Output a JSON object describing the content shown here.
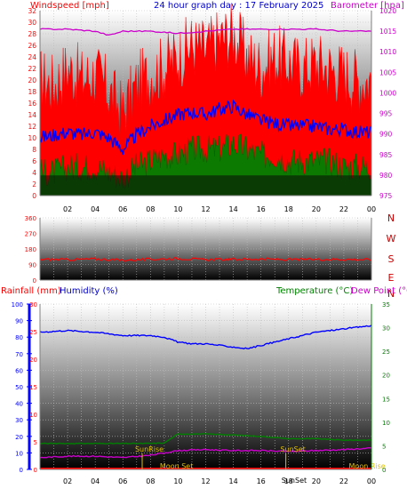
{
  "titles": {
    "main": "24 hour graph day : 17 February 2025",
    "windspeed": "Windspeed [mph]",
    "barometer": "Barometer [hpa]",
    "rainfall": "Rainfall (mm)",
    "humidity": "Humidity (%)",
    "temperature": "Temperature (°C)",
    "dewpoint": "Dew Point (°C)"
  },
  "colors": {
    "wind": "#ff0000",
    "gust_area": "#ff0000",
    "wind_avg": "#0000ff",
    "wind_low": "#008000",
    "barometer": "#cc00cc",
    "direction": "#ff0000",
    "humidity": "#0000ff",
    "temperature": "#008000",
    "dewpoint": "#cc00cc",
    "rain": "#ff0000",
    "sun": "#e0c000",
    "axis_left": "#ff0000",
    "axis_left2": "#0000ff",
    "axis_right_green": "#008000"
  },
  "chart_data": [
    {
      "type": "line",
      "title": "24 hour graph day : 17 February 2025",
      "x_ticks": [
        "02",
        "04",
        "06",
        "08",
        "10",
        "12",
        "14",
        "16",
        "18",
        "20",
        "22",
        "00"
      ],
      "ylabel": "Windspeed [mph]",
      "ylim": [
        0,
        32
      ],
      "y_ticks": [
        0,
        2,
        4,
        6,
        8,
        10,
        12,
        14,
        16,
        18,
        20,
        22,
        24,
        26,
        28,
        30,
        32
      ],
      "y2label": "Barometer [hpa]",
      "y2lim": [
        975,
        1020
      ],
      "y2_ticks": [
        975,
        980,
        985,
        990,
        995,
        1000,
        1005,
        1010,
        1015,
        1020
      ],
      "series": [
        {
          "key": "gust",
          "x": [
            0,
            1,
            2,
            3,
            4,
            5,
            6,
            7,
            8,
            9,
            10,
            11,
            12,
            13,
            14,
            15,
            16,
            17,
            18,
            19,
            20,
            21,
            22,
            23,
            24
          ],
          "values": [
            20,
            19,
            22,
            20,
            21,
            18,
            14,
            19,
            21,
            22,
            24,
            26,
            25,
            27,
            28,
            24,
            22,
            24,
            23,
            22,
            23,
            22,
            21,
            20,
            20
          ]
        },
        {
          "key": "avg",
          "x": [
            0,
            1,
            2,
            3,
            4,
            5,
            6,
            7,
            8,
            9,
            10,
            11,
            12,
            13,
            14,
            15,
            16,
            17,
            18,
            19,
            20,
            21,
            22,
            23,
            24
          ],
          "values": [
            10,
            10.5,
            11,
            10.5,
            11,
            10,
            8,
            10.5,
            12,
            13,
            14,
            14.5,
            14,
            15,
            15.5,
            14,
            13,
            12.5,
            12,
            12,
            12,
            11.5,
            11.5,
            11,
            11
          ]
        },
        {
          "key": "low",
          "x": [
            0,
            1,
            2,
            3,
            4,
            5,
            6,
            7,
            8,
            9,
            10,
            11,
            12,
            13,
            14,
            15,
            16,
            17,
            18,
            19,
            20,
            21,
            22,
            23,
            24
          ],
          "values": [
            4,
            4,
            5,
            5,
            5,
            4,
            3,
            5,
            6,
            7,
            7,
            8,
            8,
            8,
            9,
            8,
            7,
            7,
            6,
            6,
            6,
            6,
            5,
            5,
            5
          ]
        },
        {
          "key": "barometer",
          "axis": "y2",
          "x": [
            0,
            2,
            4,
            5,
            6,
            8,
            10,
            12,
            14,
            16,
            18,
            20,
            22,
            24
          ],
          "values": [
            1015.5,
            1015.5,
            1015,
            1014,
            1015,
            1015,
            1014.5,
            1015,
            1015.5,
            1015.5,
            1015.5,
            1015.5,
            1015,
            1015
          ]
        }
      ]
    },
    {
      "type": "line",
      "x_ticks": [],
      "ylim": [
        0,
        360
      ],
      "y_ticks": [
        0,
        90,
        180,
        270,
        360
      ],
      "compass": [
        "N",
        "W",
        "S",
        "E",
        "N"
      ],
      "series": [
        {
          "key": "direction",
          "x": [
            0,
            2,
            4,
            6,
            8,
            10,
            12,
            14,
            16,
            18,
            20,
            22,
            24
          ],
          "values": [
            120,
            118,
            122,
            115,
            120,
            125,
            118,
            120,
            122,
            118,
            120,
            120,
            118
          ]
        }
      ]
    },
    {
      "type": "line",
      "x_ticks": [
        "02",
        "04",
        "06",
        "08",
        "10",
        "12",
        "14",
        "16",
        "18",
        "20",
        "22",
        "00"
      ],
      "y_humidity_lim": [
        0,
        100
      ],
      "y_humidity_ticks": [
        0,
        10,
        20,
        30,
        40,
        50,
        60,
        70,
        80,
        90,
        100
      ],
      "y_rain_lim": [
        0,
        30
      ],
      "y_rain_ticks": [
        0,
        5,
        10,
        15,
        20,
        25,
        30
      ],
      "y_temp_lim": [
        0,
        35
      ],
      "y_temp_ticks": [
        0,
        5,
        10,
        15,
        20,
        25,
        30,
        35
      ],
      "series": [
        {
          "key": "humidity",
          "x": [
            0,
            1,
            2,
            3,
            4,
            5,
            6,
            7,
            8,
            9,
            10,
            11,
            12,
            13,
            14,
            15,
            16,
            17,
            18,
            19,
            20,
            21,
            22,
            23,
            24
          ],
          "values": [
            83,
            83.5,
            84,
            83.5,
            83,
            82,
            81,
            81,
            81,
            80,
            77,
            76,
            76,
            75,
            74,
            73,
            75,
            77,
            79,
            81,
            83,
            84,
            85,
            86,
            87
          ]
        },
        {
          "key": "temperature",
          "x": [
            0,
            2,
            4,
            6,
            8,
            9,
            10,
            12,
            14,
            16,
            18,
            20,
            22,
            24
          ],
          "values": [
            5.5,
            5.5,
            5.5,
            5.5,
            5.5,
            5.6,
            7.5,
            7.5,
            7.3,
            7.0,
            6.5,
            6.5,
            6.2,
            6.2
          ]
        },
        {
          "key": "dewpoint",
          "x": [
            0,
            2,
            4,
            6,
            8,
            10,
            12,
            14,
            16,
            18,
            20,
            22,
            24
          ],
          "values": [
            2.5,
            2.8,
            2.8,
            2.5,
            3,
            4,
            4.2,
            4.0,
            4.0,
            3.8,
            4.0,
            4.2,
            4.5
          ]
        },
        {
          "key": "rain",
          "x": [
            0,
            24
          ],
          "values": [
            0,
            0
          ]
        }
      ],
      "events": [
        {
          "label": "SunRise",
          "hour": 7.4
        },
        {
          "label": "SunSet",
          "hour": 17.8
        },
        {
          "label": "Moon Set",
          "hour": 9.5
        },
        {
          "label": "Moon Rise",
          "hour": 23.3
        },
        {
          "label": "SunSet",
          "hour": 18.4
        }
      ]
    }
  ]
}
